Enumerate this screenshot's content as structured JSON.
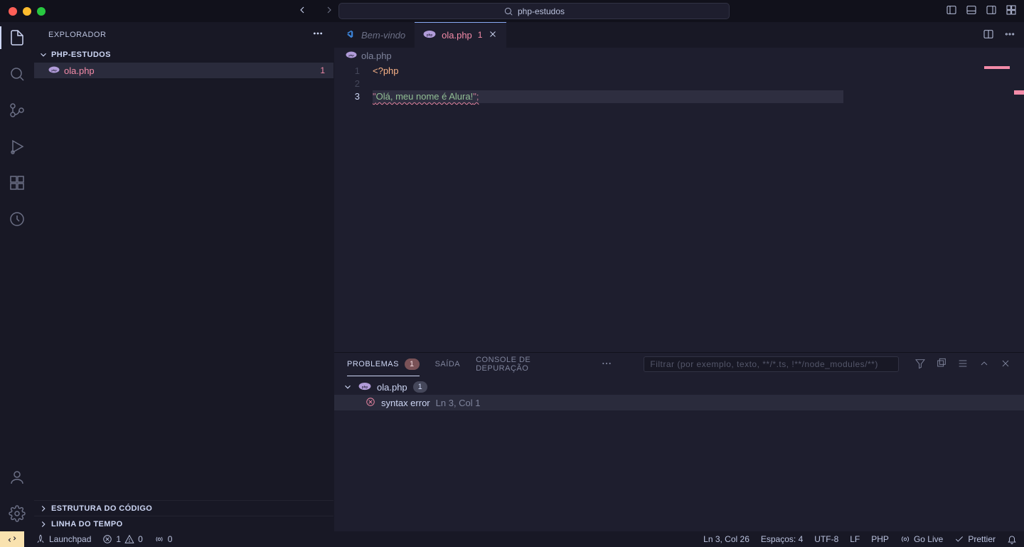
{
  "title_search": "php-estudos",
  "sidebar": {
    "title": "EXPLORADOR",
    "folder": "PHP-ESTUDOS",
    "file": {
      "name": "ola.php",
      "badge": "1"
    },
    "outline": "ESTRUTURA DO CÓDIGO",
    "timeline": "LINHA DO TEMPO"
  },
  "tabs": {
    "welcome": "Bem-vindo",
    "active": {
      "name": "ola.php",
      "badge": "1"
    }
  },
  "breadcrumb": {
    "file": "ola.php"
  },
  "code": {
    "l1_num": "1",
    "l1": "<?php",
    "l2_num": "2",
    "l3_num": "3",
    "l3_open": "\"",
    "l3_body": "Olá, meu nome é Alura!",
    "l3_close": "\";"
  },
  "panel": {
    "problems": "PROBLEMAS",
    "problems_count": "1",
    "output": "SAÍDA",
    "debug": "CONSOLE DE DEPURAÇÃO",
    "filter_placeholder": "Filtrar (por exemplo, texto, **/*.ts, !**/node_modules/**)",
    "file": "ola.php",
    "file_count": "1",
    "error_msg": "syntax error",
    "error_loc": "Ln 3, Col 1"
  },
  "statusbar": {
    "launchpad": "Launchpad",
    "err": "1",
    "warn": "0",
    "radio": "0",
    "lncol": "Ln 3, Col 26",
    "spaces": "Espaços: 4",
    "enc": "UTF-8",
    "eol": "LF",
    "lang": "PHP",
    "golive": "Go Live",
    "prettier": "Prettier"
  }
}
